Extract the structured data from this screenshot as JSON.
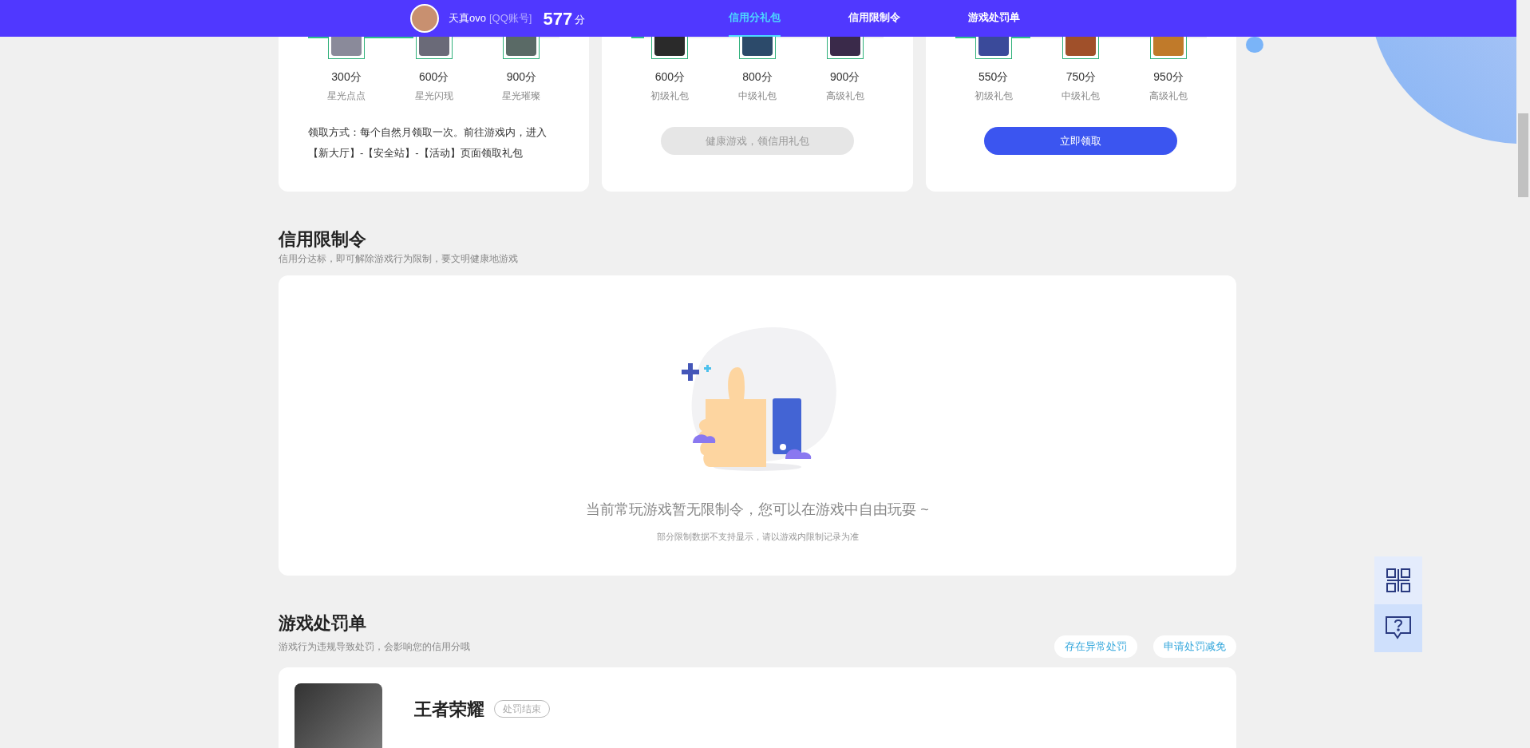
{
  "header": {
    "user_name": "天真ovo",
    "account_type": "[QQ账号]",
    "score": "577",
    "score_unit": "分",
    "tabs": [
      {
        "label": "信用分礼包",
        "selected": true
      },
      {
        "label": "信用限制令",
        "selected": false
      },
      {
        "label": "游戏处罚单",
        "selected": false
      }
    ]
  },
  "gift_cards": [
    {
      "level": 0.42,
      "tiers": [
        {
          "score": "300分",
          "name": "星光点点",
          "color": "#8a8a9a"
        },
        {
          "score": "600分",
          "name": "星光闪现",
          "color": "#6a6a78"
        },
        {
          "score": "900分",
          "name": "星光璀璨",
          "color": "#5a6a66"
        }
      ],
      "note": "领取方式：每个自然月领取一次。前往游戏内，进入【新大厅】-【安全站】-【活动】页面领取礼包"
    },
    {
      "level": 0.05,
      "tiers": [
        {
          "score": "600分",
          "name": "初级礼包",
          "color": "#2a2a2a"
        },
        {
          "score": "800分",
          "name": "中级礼包",
          "color": "#2c4a6a"
        },
        {
          "score": "900分",
          "name": "高级礼包",
          "color": "#3a2a4a"
        }
      ],
      "button": {
        "label": "健康游戏，领信用礼包",
        "disabled": true
      }
    },
    {
      "level": 0.3,
      "tiers": [
        {
          "score": "550分",
          "name": "初级礼包",
          "color": "#3a4a9a"
        },
        {
          "score": "750分",
          "name": "中级礼包",
          "color": "#a0502a"
        },
        {
          "score": "950分",
          "name": "高级礼包",
          "color": "#c07a2a"
        }
      ],
      "button": {
        "label": "立即领取",
        "disabled": false
      }
    }
  ],
  "restriction": {
    "title": "信用限制令",
    "subtitle": "信用分达标，即可解除游戏行为限制，要文明健康地游戏",
    "empty_message": "当前常玩游戏暂无限制令，您可以在游戏中自由玩耍 ~",
    "empty_note": "部分限制数据不支持显示，请以游戏内限制记录为准"
  },
  "penalty": {
    "title": "游戏处罚单",
    "subtitle": "游戏行为违规导致处罚，会影响您的信用分哦",
    "actions": [
      "存在异常处罚",
      "申请处罚减免"
    ],
    "records": [
      {
        "game": "王者荣耀",
        "status": "处罚结束"
      }
    ]
  }
}
